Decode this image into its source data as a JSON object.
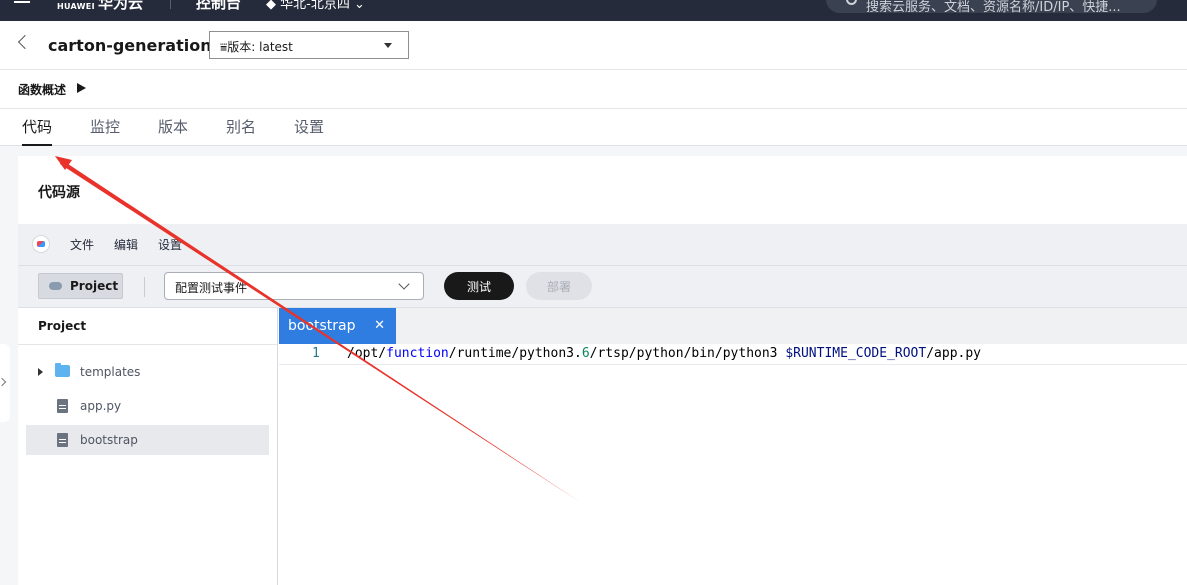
{
  "topbar": {
    "logo": "HUAWEI",
    "brand": "华为云",
    "console": "控制台",
    "region": "华北-北京四",
    "search_placeholder": "搜索云服务、文档、资源名称/ID/IP、快捷..."
  },
  "header": {
    "function_name": "carton-generation",
    "version_label": "版本: latest"
  },
  "overview": {
    "label": "函数概述"
  },
  "tabs": [
    {
      "label": "代码"
    },
    {
      "label": "监控"
    },
    {
      "label": "版本"
    },
    {
      "label": "别名"
    },
    {
      "label": "设置"
    }
  ],
  "panel": {
    "title": "代码源"
  },
  "ide": {
    "menu": [
      "文件",
      "编辑",
      "设置"
    ],
    "project_button": "Project",
    "event_select": "配置测试事件",
    "test_button": "测试",
    "deploy_button": "部署",
    "project_pane_title": "Project",
    "tree": [
      {
        "label": "templates",
        "type": "folder"
      },
      {
        "label": "app.py",
        "type": "file"
      },
      {
        "label": "bootstrap",
        "type": "file",
        "selected": true
      }
    ],
    "editor_tab": "bootstrap",
    "code": {
      "line_number": "1",
      "seg1": "/opt/",
      "seg2": "function",
      "seg3": "/runtime/python3.",
      "seg4": "6",
      "seg5": "/rtsp/python/bin/python3 ",
      "seg6": "$RUNTIME_CODE_ROOT",
      "seg7": "/app.py"
    }
  },
  "colors": {
    "annotation_arrow": "#e8322a",
    "tab_active": "#2f7de1",
    "topbar": "#252b3a"
  }
}
